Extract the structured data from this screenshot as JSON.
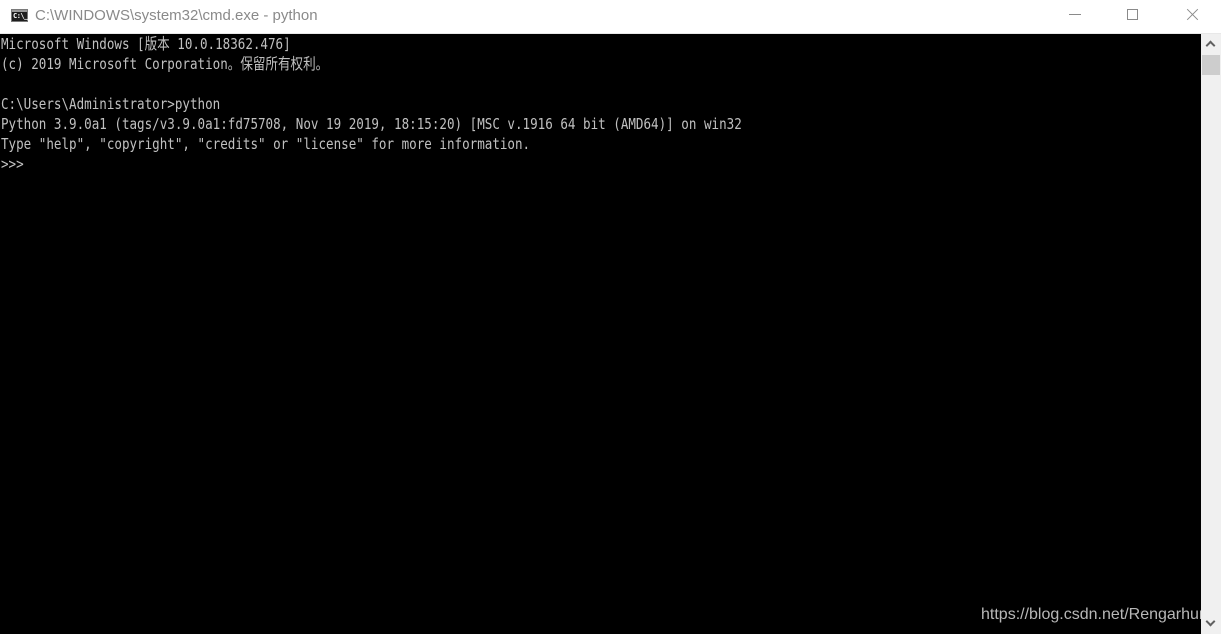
{
  "window": {
    "title": "C:\\WINDOWS\\system32\\cmd.exe - python",
    "icon": "cmd-icon",
    "icon_glyph": "C:\\_",
    "controls": {
      "minimize": "minimize-icon",
      "maximize": "maximize-icon",
      "close": "close-icon"
    }
  },
  "console": {
    "background": "#000000",
    "foreground": "#c0c0c0",
    "lines": [
      "Microsoft Windows [版本 10.0.18362.476]",
      "(c) 2019 Microsoft Corporation。保留所有权利。",
      "",
      "C:\\Users\\Administrator>python",
      "Python 3.9.0a1 (tags/v3.9.0a1:fd75708, Nov 19 2019, 18:15:20) [MSC v.1916 64 bit (AMD64)] on win32",
      "Type \"help\", \"copyright\", \"credits\" or \"license\" for more information.",
      ">>>"
    ]
  },
  "scrollbar": {
    "up": "chevron-up-icon",
    "down": "chevron-down-icon"
  },
  "watermark": "https://blog.csdn.net/Rengarhunt"
}
